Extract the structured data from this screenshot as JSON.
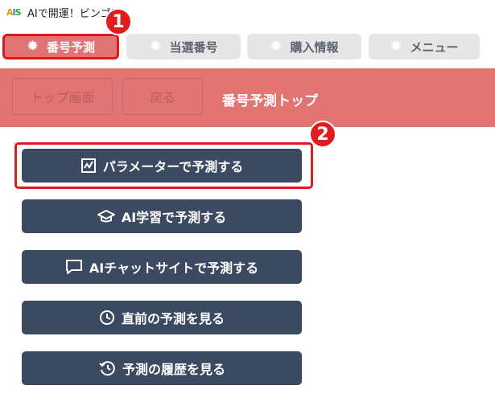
{
  "app": {
    "logo_text": "AIS",
    "title": "AIで開運！ビンゴ5"
  },
  "tabs": [
    {
      "label": "番号予測",
      "icon": "star-burst-icon",
      "active": true
    },
    {
      "label": "当選番号",
      "icon": "star-burst-icon",
      "active": false
    },
    {
      "label": "購入情報",
      "icon": "star-burst-icon",
      "active": false
    },
    {
      "label": "メニュー",
      "icon": "star-burst-icon",
      "active": false
    }
  ],
  "badges": {
    "first": "1",
    "second": "2"
  },
  "header": {
    "top_button": "トップ画面",
    "back_button": "戻る",
    "title": "番号予測トップ"
  },
  "menu": [
    {
      "label": "パラメーターで予測する",
      "icon": "chart-icon"
    },
    {
      "label": "AI学習で予測する",
      "icon": "graduation-cap-icon"
    },
    {
      "label": "AIチャットサイトで予測する",
      "icon": "chat-bubble-icon"
    },
    {
      "label": "直前の予測を見る",
      "icon": "clock-icon"
    },
    {
      "label": "予測の履歴を見る",
      "icon": "history-icon"
    }
  ],
  "colors": {
    "accent": "#e27474",
    "highlight": "#d81b1b",
    "button": "#3b4a60"
  }
}
